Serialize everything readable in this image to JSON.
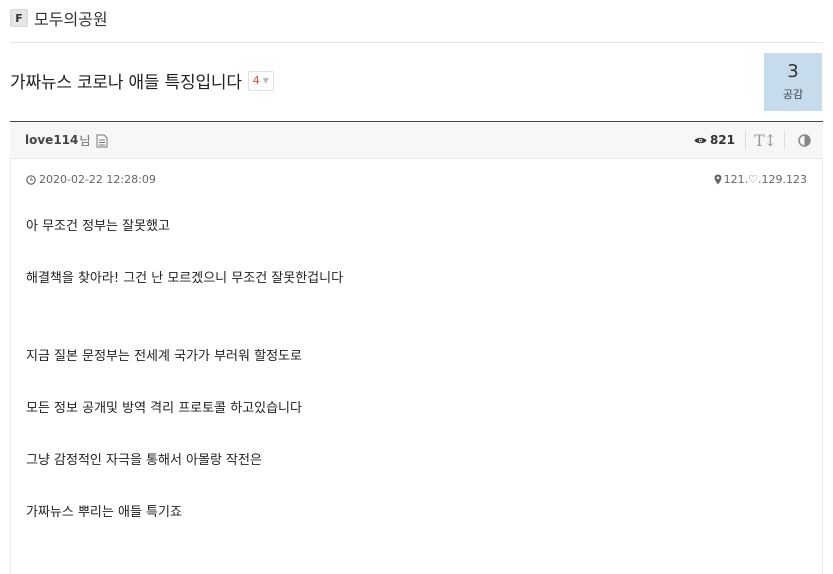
{
  "board": {
    "badge": "F",
    "name": "모두의공원"
  },
  "post": {
    "title": "가짜뉴스 코로나 애들 특징입니다",
    "comment_count": "4",
    "like_count": "3",
    "like_label": "공감",
    "author": "love114",
    "author_suffix": "님",
    "views": "821",
    "datetime": "2020-02-22 12:28:09",
    "ip": "121.♡.129.123",
    "lines": [
      "아 무조건 정부는 잘못했고",
      "해결책을 찾아라! 그건 난 모르겠으니 무조건 잘못한겁니다",
      "지금 질본 문정부는 전세계 국가가 부러워 할정도로",
      "모든 정보 공개및 방역 격리 프로토콜 하고있습니다",
      "그냥 감정적인 자극을 통해서 아몰랑 작전은",
      "가짜뉴스 뿌리는 애들 특기죠"
    ]
  },
  "icons": {
    "doc": "document-icon",
    "views": "eye-icon",
    "font": "font-size-icon",
    "contrast": "contrast-icon",
    "clock": "clock-icon",
    "location": "location-icon",
    "chevron": "chevron-down-icon"
  },
  "colors": {
    "like_box_bg": "#c6dcec",
    "comment_count": "#e8502a",
    "meta_border": "#3c4a52"
  }
}
